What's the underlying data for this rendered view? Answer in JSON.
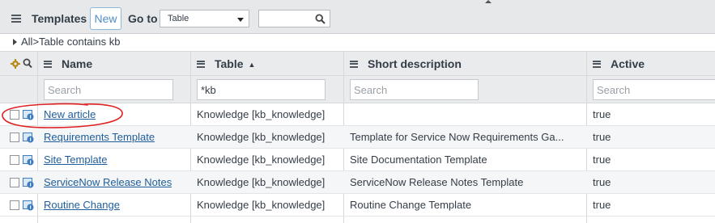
{
  "header": {
    "title": "Templates",
    "new_label": "New",
    "goto_label": "Go to",
    "goto_selected": "Table",
    "search_value": ""
  },
  "breadcrumb": {
    "all": "All",
    "sep": ">",
    "filter": "Table contains kb"
  },
  "columns": {
    "name": "Name",
    "table": "Table",
    "table_sort": "▲",
    "short_description": "Short description",
    "active": "Active"
  },
  "filters": {
    "name_placeholder": "Search",
    "table_value": "*kb",
    "desc_placeholder": "Search",
    "active_placeholder": "Search"
  },
  "rows": [
    {
      "name": "New article",
      "table": "Knowledge [kb_knowledge]",
      "description": "",
      "active": "true"
    },
    {
      "name": "Requirements Template",
      "table": "Knowledge [kb_knowledge]",
      "description": "Template for Service Now Requirements Ga...",
      "active": "true"
    },
    {
      "name": "Site Template",
      "table": "Knowledge [kb_knowledge]",
      "description": "Site Documentation Template",
      "active": "true"
    },
    {
      "name": "ServiceNow Release Notes",
      "table": "Knowledge [kb_knowledge]",
      "description": "ServiceNow Release Notes Template",
      "active": "true"
    },
    {
      "name": "Routine Change",
      "table": "Knowledge [kb_knowledge]",
      "description": "Routine Change Template",
      "active": "true"
    }
  ],
  "icons": {
    "menu": "hamburger-icon",
    "search": "search-icon",
    "gear": "gear-icon",
    "record": "record-preview-icon"
  },
  "colors": {
    "header_bg": "#e6e8ea",
    "link": "#1f5d9a",
    "annotation": "#e02020"
  }
}
